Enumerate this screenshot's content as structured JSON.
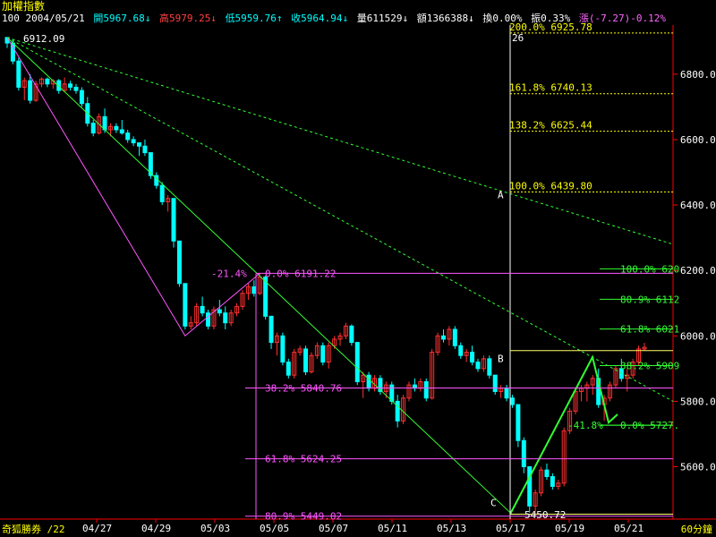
{
  "window": {
    "title": "加權指數",
    "footer_left": "奇狐勝券 /22",
    "interval": "60分鐘"
  },
  "quote": {
    "prefix": "100 2004/05/21",
    "open": "開5967.68↓",
    "high": "高5979.25↓",
    "low": "低5959.76↑",
    "close": "收5964.94↓",
    "volume": "量611529↓",
    "amount": "額1366388↓",
    "turnover": "換0.00%",
    "amplitude": "振0.33%",
    "change": "漲(-7.27)-0.12%"
  },
  "colors": {
    "up": "#ff3030",
    "down": "#00ffff",
    "grid": "#ff55ff",
    "fib": "#ffff00",
    "trend": "#33ff33",
    "axis": "#ff0000"
  },
  "chart_data": {
    "type": "candlestick",
    "y_axis_ticks": [
      "6800.0",
      "6600.0",
      "6400.0",
      "6200.0",
      "6000.0",
      "5800.0",
      "5600.0"
    ],
    "ylim": [
      5440,
      6950
    ],
    "x_tick_labels": [
      "04/27",
      "04/29",
      "05/03",
      "05/05",
      "05/07",
      "05/11",
      "05/13",
      "05/17",
      "05/19",
      "05/21"
    ],
    "candles": [
      [
        6912,
        6912,
        6880,
        6895
      ],
      [
        6895,
        6905,
        6830,
        6840
      ],
      [
        6840,
        6850,
        6750,
        6760
      ],
      [
        6760,
        6790,
        6720,
        6780
      ],
      [
        6780,
        6800,
        6710,
        6720
      ],
      [
        6720,
        6780,
        6715,
        6770
      ],
      [
        6770,
        6790,
        6760,
        6785
      ],
      [
        6785,
        6790,
        6760,
        6770
      ],
      [
        6770,
        6785,
        6755,
        6780
      ],
      [
        6780,
        6785,
        6740,
        6750
      ],
      [
        6750,
        6790,
        6745,
        6770
      ],
      [
        6770,
        6780,
        6750,
        6760
      ],
      [
        6760,
        6770,
        6740,
        6750
      ],
      [
        6750,
        6760,
        6700,
        6710
      ],
      [
        6710,
        6730,
        6640,
        6650
      ],
      [
        6650,
        6660,
        6610,
        6620
      ],
      [
        6620,
        6680,
        6615,
        6670
      ],
      [
        6670,
        6695,
        6620,
        6630
      ],
      [
        6630,
        6650,
        6610,
        6640
      ],
      [
        6640,
        6650,
        6620,
        6630
      ],
      [
        6630,
        6660,
        6615,
        6620
      ],
      [
        6620,
        6630,
        6590,
        6600
      ],
      [
        6600,
        6610,
        6580,
        6590
      ],
      [
        6590,
        6590,
        6550,
        6580
      ],
      [
        6580,
        6600,
        6550,
        6560
      ],
      [
        6560,
        6560,
        6480,
        6490
      ],
      [
        6490,
        6500,
        6450,
        6460
      ],
      [
        6460,
        6470,
        6400,
        6410
      ],
      [
        6410,
        6430,
        6380,
        6420
      ],
      [
        6420,
        6420,
        6270,
        6290
      ],
      [
        6290,
        6290,
        6150,
        6160
      ],
      [
        6160,
        6160,
        6020,
        6030
      ],
      [
        6030,
        6060,
        6020,
        6040
      ],
      [
        6040,
        6100,
        6030,
        6090
      ],
      [
        6090,
        6120,
        6060,
        6070
      ],
      [
        6070,
        6080,
        6020,
        6030
      ],
      [
        6030,
        6090,
        6020,
        6080
      ],
      [
        6080,
        6110,
        6060,
        6070
      ],
      [
        6070,
        6090,
        6020,
        6040
      ],
      [
        6040,
        6080,
        6030,
        6070
      ],
      [
        6070,
        6100,
        6060,
        6090
      ],
      [
        6090,
        6140,
        6080,
        6130
      ],
      [
        6130,
        6160,
        6110,
        6150
      ],
      [
        6150,
        6170,
        6120,
        6130
      ],
      [
        6130,
        6191,
        6125,
        6180
      ],
      [
        6180,
        6185,
        6050,
        6060
      ],
      [
        6060,
        6060,
        5960,
        5980
      ],
      [
        5980,
        6010,
        5940,
        6000
      ],
      [
        6000,
        6010,
        5910,
        5920
      ],
      [
        5920,
        5930,
        5870,
        5880
      ],
      [
        5880,
        5960,
        5870,
        5950
      ],
      [
        5950,
        5970,
        5940,
        5960
      ],
      [
        5960,
        5970,
        5880,
        5890
      ],
      [
        5890,
        5950,
        5885,
        5940
      ],
      [
        5940,
        5980,
        5930,
        5970
      ],
      [
        5970,
        5980,
        5910,
        5920
      ],
      [
        5920,
        5980,
        5900,
        5970
      ],
      [
        5970,
        6000,
        5960,
        5990
      ],
      [
        5990,
        6010,
        5970,
        6000
      ],
      [
        6000,
        6040,
        5990,
        6030
      ],
      [
        6030,
        6035,
        5970,
        5980
      ],
      [
        5980,
        5980,
        5850,
        5860
      ],
      [
        5860,
        5890,
        5810,
        5880
      ],
      [
        5880,
        5890,
        5830,
        5840
      ],
      [
        5840,
        5880,
        5830,
        5870
      ],
      [
        5870,
        5880,
        5820,
        5830
      ],
      [
        5830,
        5860,
        5810,
        5850
      ],
      [
        5850,
        5860,
        5790,
        5800
      ],
      [
        5800,
        5820,
        5720,
        5740
      ],
      [
        5740,
        5820,
        5730,
        5810
      ],
      [
        5810,
        5860,
        5800,
        5850
      ],
      [
        5850,
        5870,
        5830,
        5840
      ],
      [
        5840,
        5870,
        5830,
        5860
      ],
      [
        5860,
        5870,
        5800,
        5810
      ],
      [
        5810,
        5960,
        5805,
        5950
      ],
      [
        5950,
        6010,
        5940,
        6000
      ],
      [
        6000,
        6020,
        5980,
        5990
      ],
      [
        5990,
        6030,
        5970,
        6020
      ],
      [
        6020,
        6030,
        5960,
        5970
      ],
      [
        5970,
        5980,
        5930,
        5940
      ],
      [
        5940,
        5960,
        5920,
        5950
      ],
      [
        5950,
        5970,
        5910,
        5920
      ],
      [
        5920,
        5930,
        5890,
        5900
      ],
      [
        5900,
        5940,
        5890,
        5930
      ],
      [
        5930,
        5940,
        5870,
        5880
      ],
      [
        5880,
        5880,
        5820,
        5830
      ],
      [
        5830,
        5850,
        5810,
        5840
      ],
      [
        5840,
        5850,
        5800,
        5810
      ],
      [
        5810,
        5820,
        5780,
        5790
      ],
      [
        5790,
        5790,
        5660,
        5680
      ],
      [
        5680,
        5690,
        5580,
        5600
      ],
      [
        5600,
        5600,
        5460,
        5480
      ],
      [
        5480,
        5530,
        5450,
        5520
      ],
      [
        5520,
        5600,
        5510,
        5590
      ],
      [
        5590,
        5610,
        5560,
        5570
      ],
      [
        5570,
        5580,
        5530,
        5540
      ],
      [
        5540,
        5560,
        5530,
        5550
      ],
      [
        5550,
        5720,
        5540,
        5710
      ],
      [
        5710,
        5780,
        5700,
        5770
      ],
      [
        5770,
        5840,
        5760,
        5830
      ],
      [
        5830,
        5850,
        5800,
        5840
      ],
      [
        5840,
        5860,
        5800,
        5850
      ],
      [
        5850,
        5880,
        5820,
        5870
      ],
      [
        5870,
        5900,
        5780,
        5790
      ],
      [
        5790,
        5820,
        5740,
        5810
      ],
      [
        5810,
        5860,
        5800,
        5850
      ],
      [
        5850,
        5910,
        5840,
        5900
      ],
      [
        5900,
        5930,
        5860,
        5870
      ],
      [
        5870,
        5900,
        5830,
        5880
      ],
      [
        5880,
        5930,
        5870,
        5920
      ],
      [
        5920,
        5970,
        5910,
        5960
      ],
      [
        5960,
        5979,
        5955,
        5965
      ]
    ],
    "trend_low_label": "6912.09",
    "fib_upper": [
      {
        "label": "200.0% 6925.78",
        "value": 6925.78
      },
      {
        "label": "161.8% 6740.13",
        "value": 6740.13
      },
      {
        "label": "138.2% 6625.44",
        "value": 6625.44
      },
      {
        "label": "100.0% 6439.80",
        "value": 6439.8
      }
    ],
    "fib_left": [
      {
        "label": "-21.4%",
        "value": 6191.22
      },
      {
        "label": "0.0% 6191.22",
        "value": 6191.22
      },
      {
        "label": "38.2% 5840.76",
        "value": 5840.76
      },
      {
        "label": "61.8% 5624.25",
        "value": 5624.25
      },
      {
        "label": "80.9% 5449.02",
        "value": 5449.02
      }
    ],
    "fib_right": [
      {
        "label": "100.0% 620",
        "value": 6205
      },
      {
        "label": "80.9% 6112",
        "value": 6112
      },
      {
        "label": "61.8% 6021",
        "value": 6021
      },
      {
        "label": "38.2% 5909",
        "value": 5909
      },
      {
        "label": "-41.8%",
        "value": 5727
      },
      {
        "label": "0.0% 5727.",
        "value": 5727
      }
    ],
    "low_label": "5450.72",
    "wave_points": [
      "A",
      "B",
      "C"
    ],
    "cursor_label": "26"
  }
}
